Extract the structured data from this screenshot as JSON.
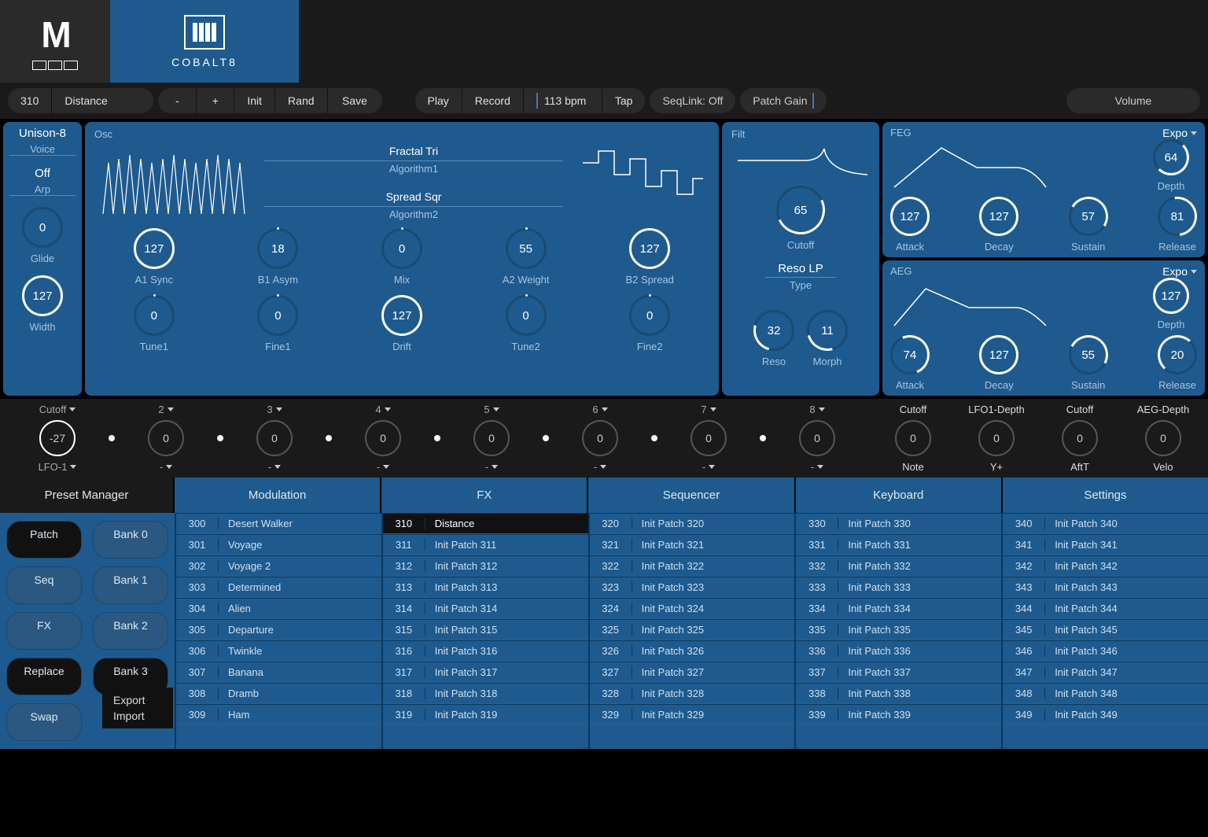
{
  "header": {
    "product": "COBALT8"
  },
  "toolbar": {
    "patch_num": "310",
    "patch_name": "Distance",
    "minus": "-",
    "plus": "+",
    "init": "Init",
    "rand": "Rand",
    "save": "Save",
    "play": "Play",
    "record": "Record",
    "bpm": "113 bpm",
    "tap": "Tap",
    "seqlink": "SeqLink: Off",
    "patch_gain": "Patch Gain",
    "volume": "Volume"
  },
  "voice": {
    "mode_val": "Unison-8",
    "mode_lbl": "Voice",
    "arp_val": "Off",
    "arp_lbl": "Arp",
    "glide": {
      "val": "0",
      "lbl": "Glide"
    },
    "width": {
      "val": "127",
      "lbl": "Width"
    }
  },
  "osc": {
    "title": "Osc",
    "alg1_name": "Fractal Tri",
    "alg1_sub": "Algorithm1",
    "alg2_name": "Spread Sqr",
    "alg2_sub": "Algorithm2",
    "knobs_r1": [
      {
        "val": "127",
        "lbl": "A1 Sync",
        "full": true
      },
      {
        "val": "18",
        "lbl": "B1 Asym",
        "full": false
      },
      {
        "val": "0",
        "lbl": "Mix",
        "full": false
      },
      {
        "val": "55",
        "lbl": "A2 Weight",
        "full": false
      },
      {
        "val": "127",
        "lbl": "B2 Spread",
        "full": true
      }
    ],
    "knobs_r2": [
      {
        "val": "0",
        "lbl": "Tune1",
        "full": false
      },
      {
        "val": "0",
        "lbl": "Fine1",
        "full": false
      },
      {
        "val": "127",
        "lbl": "Drift",
        "full": true
      },
      {
        "val": "0",
        "lbl": "Tune2",
        "full": false
      },
      {
        "val": "0",
        "lbl": "Fine2",
        "full": false
      }
    ]
  },
  "filt": {
    "title": "Filt",
    "cutoff": {
      "val": "65",
      "lbl": "Cutoff"
    },
    "type_val": "Reso LP",
    "type_lbl": "Type",
    "reso": {
      "val": "32",
      "lbl": "Reso"
    },
    "morph": {
      "val": "11",
      "lbl": "Morph"
    }
  },
  "feg": {
    "title": "FEG",
    "curve": "Expo",
    "depth": {
      "val": "64",
      "lbl": "Depth"
    },
    "adsr": [
      {
        "val": "127",
        "lbl": "Attack"
      },
      {
        "val": "127",
        "lbl": "Decay"
      },
      {
        "val": "57",
        "lbl": "Sustain"
      },
      {
        "val": "81",
        "lbl": "Release"
      }
    ]
  },
  "aeg": {
    "title": "AEG",
    "curve": "Expo",
    "depth": {
      "val": "127",
      "lbl": "Depth"
    },
    "adsr": [
      {
        "val": "74",
        "lbl": "Attack"
      },
      {
        "val": "127",
        "lbl": "Decay"
      },
      {
        "val": "55",
        "lbl": "Sustain"
      },
      {
        "val": "20",
        "lbl": "Release"
      }
    ]
  },
  "mod": {
    "slots": [
      {
        "top": "Cutoff",
        "val": "-27",
        "bot": "LFO-1",
        "active": true
      },
      {
        "top": "2",
        "val": "0",
        "bot": "-"
      },
      {
        "top": "3",
        "val": "0",
        "bot": "-"
      },
      {
        "top": "4",
        "val": "0",
        "bot": "-"
      },
      {
        "top": "5",
        "val": "0",
        "bot": "-"
      },
      {
        "top": "6",
        "val": "0",
        "bot": "-"
      },
      {
        "top": "7",
        "val": "0",
        "bot": "-"
      },
      {
        "top": "8",
        "val": "0",
        "bot": "-"
      }
    ],
    "fixed": [
      {
        "top": "Cutoff",
        "val": "0",
        "bot": "Note"
      },
      {
        "top": "LFO1-Depth",
        "val": "0",
        "bot": "Y+"
      },
      {
        "top": "Cutoff",
        "val": "0",
        "bot": "AftT"
      },
      {
        "top": "AEG-Depth",
        "val": "0",
        "bot": "Velo"
      }
    ]
  },
  "tabs": [
    "Preset Manager",
    "Modulation",
    "FX",
    "Sequencer",
    "Keyboard",
    "Settings"
  ],
  "preset": {
    "left_col1": [
      "Patch",
      "Seq",
      "FX",
      "Replace",
      "Swap"
    ],
    "left_col2": [
      "Bank 0",
      "Bank 1",
      "Bank 2",
      "Bank 3"
    ],
    "ctx": [
      "Export",
      "Import"
    ],
    "cols": [
      [
        [
          "300",
          "Desert Walker"
        ],
        [
          "301",
          "Voyage"
        ],
        [
          "302",
          "Voyage 2"
        ],
        [
          "303",
          "Determined"
        ],
        [
          "304",
          "Alien"
        ],
        [
          "305",
          "Departure"
        ],
        [
          "306",
          "Twinkle"
        ],
        [
          "307",
          "Banana"
        ],
        [
          "308",
          "Dramb"
        ],
        [
          "309",
          "Ham"
        ]
      ],
      [
        [
          "310",
          "Distance"
        ],
        [
          "311",
          "Init Patch 311"
        ],
        [
          "312",
          "Init Patch 312"
        ],
        [
          "313",
          "Init Patch 313"
        ],
        [
          "314",
          "Init Patch 314"
        ],
        [
          "315",
          "Init Patch 315"
        ],
        [
          "316",
          "Init Patch 316"
        ],
        [
          "317",
          "Init Patch 317"
        ],
        [
          "318",
          "Init Patch 318"
        ],
        [
          "319",
          "Init Patch 319"
        ]
      ],
      [
        [
          "320",
          "Init Patch 320"
        ],
        [
          "321",
          "Init Patch 321"
        ],
        [
          "322",
          "Init Patch 322"
        ],
        [
          "323",
          "Init Patch 323"
        ],
        [
          "324",
          "Init Patch 324"
        ],
        [
          "325",
          "Init Patch 325"
        ],
        [
          "326",
          "Init Patch 326"
        ],
        [
          "327",
          "Init Patch 327"
        ],
        [
          "328",
          "Init Patch 328"
        ],
        [
          "329",
          "Init Patch 329"
        ]
      ],
      [
        [
          "330",
          "Init Patch 330"
        ],
        [
          "331",
          "Init Patch 331"
        ],
        [
          "332",
          "Init Patch 332"
        ],
        [
          "333",
          "Init Patch 333"
        ],
        [
          "334",
          "Init Patch 334"
        ],
        [
          "335",
          "Init Patch 335"
        ],
        [
          "336",
          "Init Patch 336"
        ],
        [
          "337",
          "Init Patch 337"
        ],
        [
          "338",
          "Init Patch 338"
        ],
        [
          "339",
          "Init Patch 339"
        ]
      ],
      [
        [
          "340",
          "Init Patch 340"
        ],
        [
          "341",
          "Init Patch 341"
        ],
        [
          "342",
          "Init Patch 342"
        ],
        [
          "343",
          "Init Patch 343"
        ],
        [
          "344",
          "Init Patch 344"
        ],
        [
          "345",
          "Init Patch 345"
        ],
        [
          "346",
          "Init Patch 346"
        ],
        [
          "347",
          "Init Patch 347"
        ],
        [
          "348",
          "Init Patch 348"
        ],
        [
          "349",
          "Init Patch 349"
        ]
      ]
    ],
    "selected_num": "310"
  }
}
